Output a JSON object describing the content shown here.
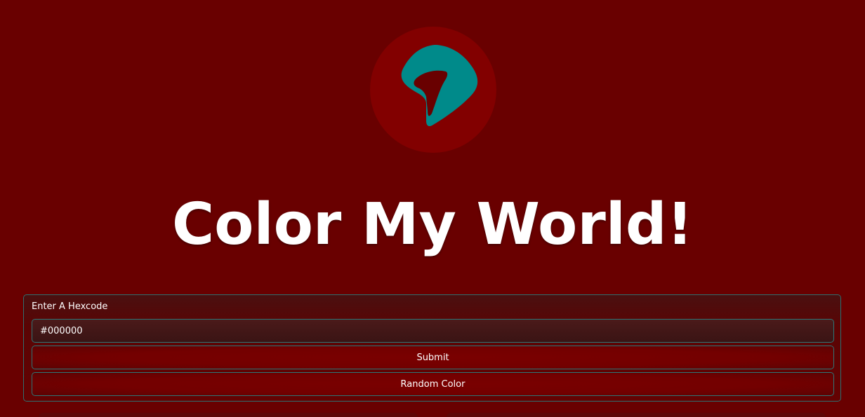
{
  "app": {
    "title": "Color My World!"
  },
  "logo": {
    "icon": "app-logo-icon",
    "circle_color": "#820000",
    "mark_color": "#008a8a"
  },
  "form": {
    "label": "Enter A Hexcode",
    "hex_value": "#000000",
    "submit_label": "Submit",
    "random_label": "Random Color"
  },
  "colors": {
    "background": "#690000",
    "accent_border": "#2f7777"
  }
}
